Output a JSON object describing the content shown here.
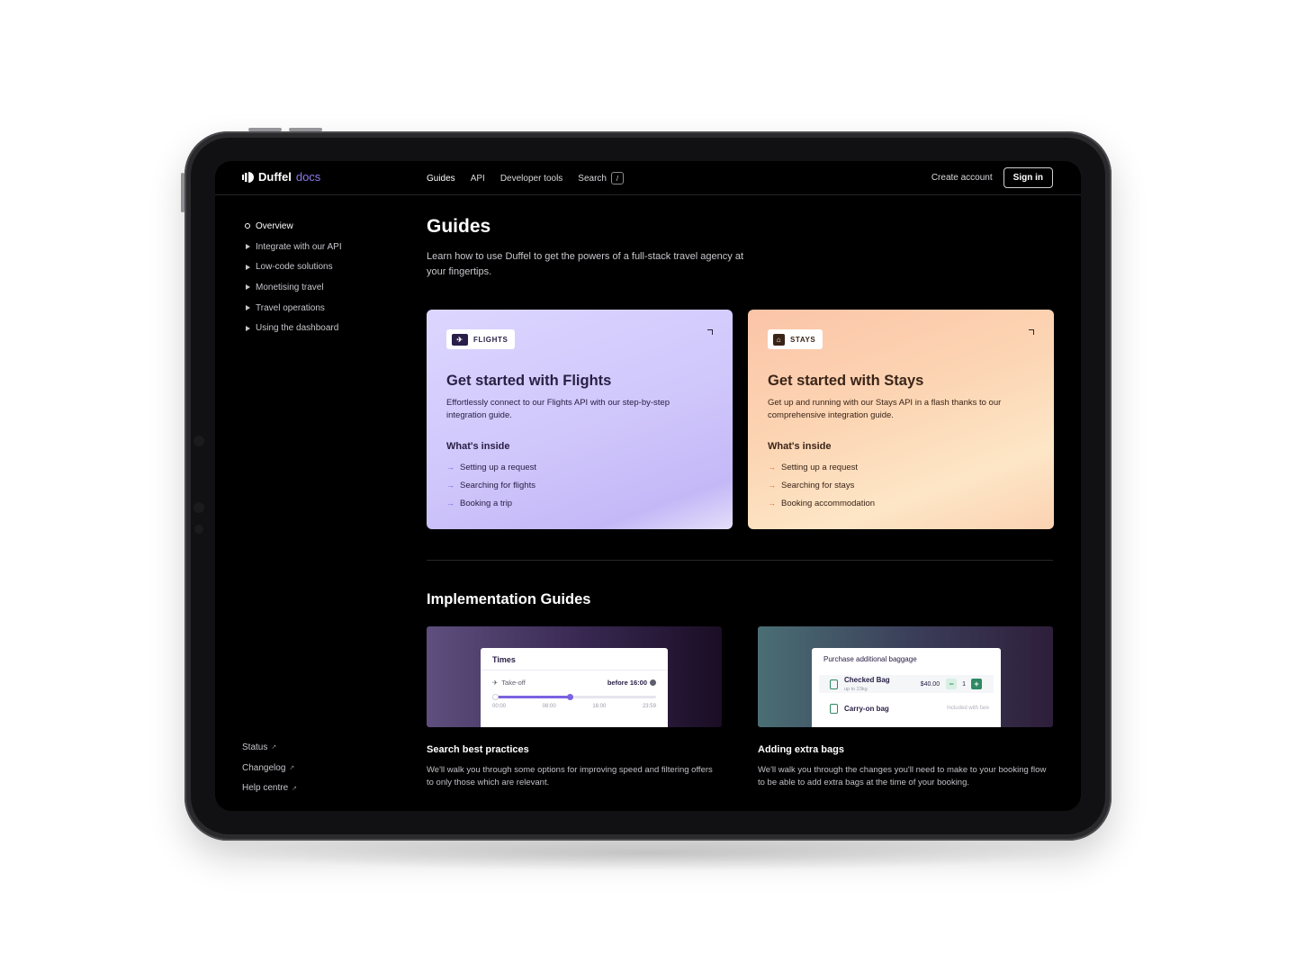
{
  "brand": {
    "name": "Duffel",
    "suffix": "docs"
  },
  "nav": {
    "items": [
      "Guides",
      "API",
      "Developer tools",
      "Search"
    ],
    "search_shortcut": "/",
    "create_account": "Create account",
    "sign_in": "Sign in"
  },
  "sidebar": {
    "items": [
      "Overview",
      "Integrate with our API",
      "Low-code solutions",
      "Monetising travel",
      "Travel operations",
      "Using the dashboard"
    ],
    "footer": [
      "Status",
      "Changelog",
      "Help centre"
    ]
  },
  "page": {
    "title": "Guides",
    "subtitle": "Learn how to use Duffel to get the powers of a full-stack travel agency at your fingertips."
  },
  "cards": [
    {
      "badge": "FLIGHTS",
      "title": "Get started with Flights",
      "description": "Effortlessly connect to our Flights API with our step-by-step integration guide.",
      "inside_heading": "What's inside",
      "items": [
        "Setting up a request",
        "Searching for flights",
        "Booking a trip"
      ]
    },
    {
      "badge": "STAYS",
      "title": "Get started with Stays",
      "description": "Get up and running with our Stays API in a flash thanks to our comprehensive integration guide.",
      "inside_heading": "What's inside",
      "items": [
        "Setting up a request",
        "Searching for stays",
        "Booking accommodation"
      ]
    }
  ],
  "implementation": {
    "title": "Implementation Guides",
    "guides": [
      {
        "title": "Search best practices",
        "description": "We'll walk you through some options for improving speed and filtering offers to only those which are relevant.",
        "mock": {
          "heading": "Times",
          "row_label": "Take-off",
          "row_value": "before 16:00",
          "slider_fraction": 0.47,
          "ticks": [
            "00:00",
            "08:00",
            "16:00",
            "23:59"
          ]
        }
      },
      {
        "title": "Adding extra bags",
        "description": "We'll walk you through the changes you'll need to make to your booking flow to be able to add extra bags at the time of your booking.",
        "mock": {
          "heading": "Purchase additional baggage",
          "bag1_name": "Checked Bag",
          "bag1_note": "up to 23kg",
          "bag1_price": "$40.00",
          "bag1_qty": "1",
          "bag2_name": "Carry-on bag",
          "bag2_note": "Included with fare"
        }
      }
    ]
  },
  "colors": {
    "accent": "#7a62e0",
    "stays_accent": "#e06a32",
    "bag_green": "#2e8a64"
  }
}
